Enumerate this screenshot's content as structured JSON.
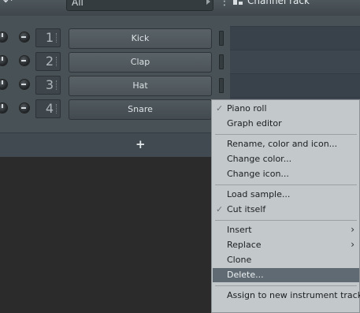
{
  "toolbar": {
    "filter_value": "All",
    "more_glyph": "⋮",
    "title": "Channel rack"
  },
  "channels": [
    {
      "number": "1",
      "name": "Kick"
    },
    {
      "number": "2",
      "name": "Clap"
    },
    {
      "number": "3",
      "name": "Hat"
    },
    {
      "number": "4",
      "name": "Snare"
    }
  ],
  "add_button_label": "+",
  "context_menu": {
    "items": [
      {
        "label": "Piano roll",
        "checked": true
      },
      {
        "label": "Graph editor"
      },
      {
        "label": "Rename, color and icon..."
      },
      {
        "label": "Change color..."
      },
      {
        "label": "Change icon..."
      },
      {
        "label": "Load sample..."
      },
      {
        "label": "Cut itself",
        "checked": true
      },
      {
        "label": "Insert",
        "submenu": true
      },
      {
        "label": "Replace",
        "submenu": true
      },
      {
        "label": "Clone"
      },
      {
        "label": "Delete...",
        "highlighted": true
      },
      {
        "label": "Assign to new instrument track"
      }
    ],
    "check_glyph": "✓",
    "submenu_glyph": "›"
  }
}
